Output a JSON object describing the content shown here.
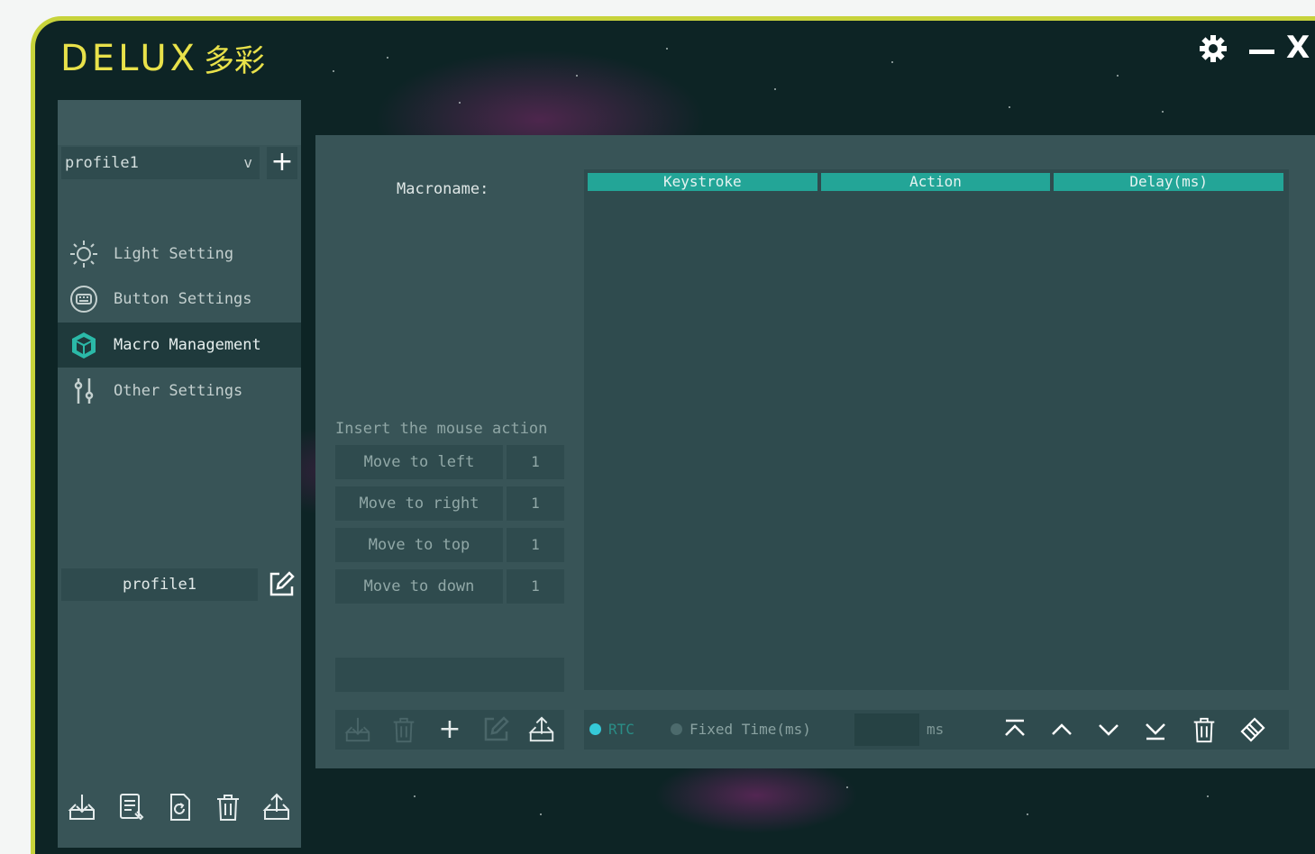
{
  "app": {
    "brand": "DELUX",
    "brand_cn": "多彩",
    "window_close_label": "X"
  },
  "icons": {
    "settings": "gear-icon",
    "minimize": "minimize-icon",
    "close": "close-icon",
    "light": "light-bulb-icon",
    "button": "keyboard-icon",
    "macro": "cube-icon",
    "other": "sliders-icon",
    "edit": "edit-icon",
    "import": "import-icon",
    "export": "export-icon",
    "delete": "trash-icon",
    "add": "plus-icon"
  },
  "colors": {
    "accent": "#23a597",
    "border": "#c7d33b",
    "brand": "#e8e14a",
    "panel": "#385457",
    "field": "#2f4b4e"
  },
  "sidebar": {
    "profile_selected": "profile1",
    "profile_add_label": "+",
    "items": [
      {
        "label": "Light Setting"
      },
      {
        "label": "Button Settings"
      },
      {
        "label": "Macro Management"
      },
      {
        "label": "Other Settings"
      }
    ],
    "profile_name": "profile1"
  },
  "macro": {
    "macroname_label": "Macroname:",
    "mouse_section_title": "Insert the mouse action",
    "mouse_actions": [
      {
        "label": "Move to left",
        "value": "1"
      },
      {
        "label": "Move to right",
        "value": "1"
      },
      {
        "label": "Move to top",
        "value": "1"
      },
      {
        "label": "Move to down",
        "value": "1"
      }
    ],
    "toolbar_add_label": "+"
  },
  "table": {
    "columns": [
      "Keystroke",
      "Action",
      "Delay(ms)"
    ]
  },
  "delay": {
    "rtc_label": "RTC",
    "fixed_label": "Fixed Time(ms)",
    "ms_value": "",
    "ms_unit": "ms"
  }
}
